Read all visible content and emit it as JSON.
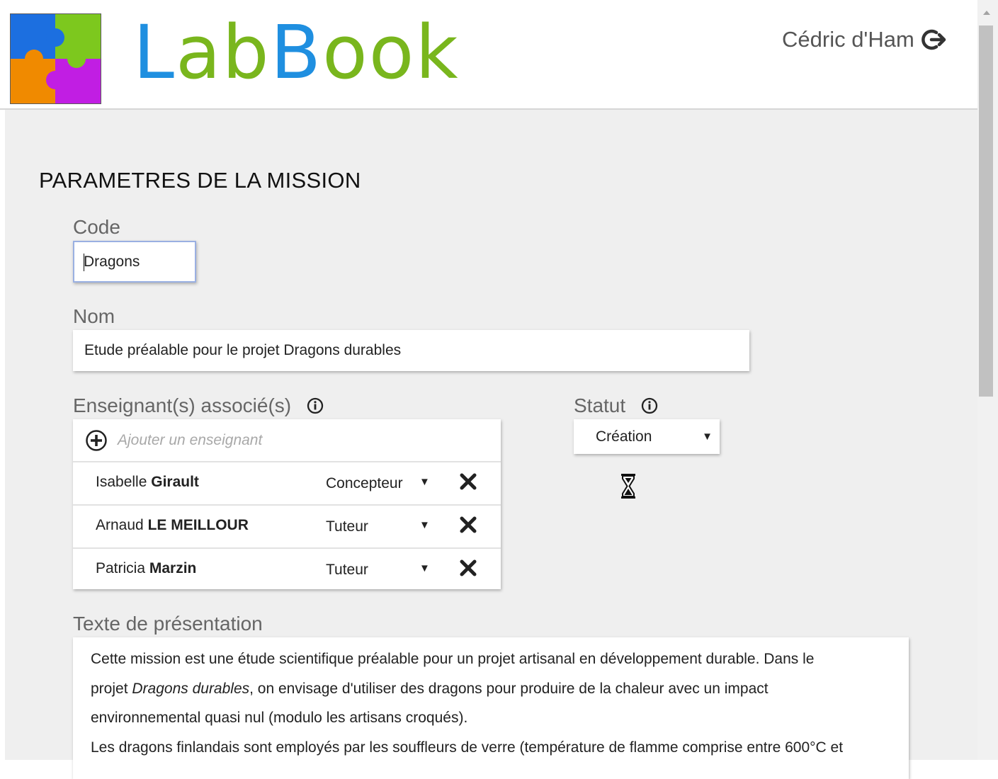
{
  "header": {
    "app_name": "LabBook",
    "brand_parts": [
      {
        "text": "L",
        "color": "#1f8fe0"
      },
      {
        "text": "ab",
        "color": "#79b61d"
      },
      {
        "text": "B",
        "color": "#1f8fe0"
      },
      {
        "text": "ook",
        "color": "#79b61d"
      }
    ],
    "user_name": "Cédric d'Ham",
    "logout_icon": "logout-icon"
  },
  "page": {
    "title": "PARAMETRES DE LA MISSION"
  },
  "form": {
    "code": {
      "label": "Code",
      "value": "Dragons"
    },
    "nom": {
      "label": "Nom",
      "value": "Etude préalable pour le projet Dragons durables"
    },
    "enseignants": {
      "label": "Enseignant(s) associé(s)",
      "add_placeholder": "Ajouter un enseignant",
      "items": [
        {
          "first": "Isabelle",
          "last": "Girault",
          "role": "Concepteur"
        },
        {
          "first": "Arnaud",
          "last": "LE MEILLOUR",
          "role": "Tuteur"
        },
        {
          "first": "Patricia",
          "last": "Marzin",
          "role": "Tuteur"
        }
      ]
    },
    "statut": {
      "label": "Statut",
      "value": "Création"
    },
    "presentation": {
      "label": "Texte de présentation",
      "line1": "Cette mission est une étude scientifique préalable pour un projet artisanal en développement durable. Dans le",
      "line2_pre": "projet ",
      "line2_em": "Dragons durables",
      "line2_post": ", on envisage d'utiliser des dragons pour produire de la chaleur avec un impact",
      "line3": "environnemental quasi nul (modulo les artisans croqués).",
      "line4": "Les dragons finlandais sont employés par les souffleurs de verre (température de flamme comprise entre 600°C et"
    }
  },
  "icons": {
    "dropdown_arrow": "▼",
    "info": "info-icon",
    "add": "add-circle-icon",
    "delete": "close-icon",
    "pending": "hourglass-icon"
  },
  "colors": {
    "brand_blue": "#1f8fe0",
    "brand_green": "#79b61d",
    "focus_border": "#9ab0e2",
    "background": "#efefef"
  }
}
